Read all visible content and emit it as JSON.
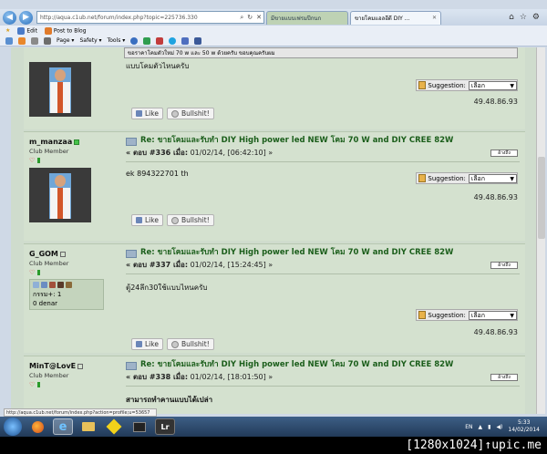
{
  "browser": {
    "address_url": "http://aqua.c1ub.net/forum/index.php?topic=225736.330",
    "tabs": [
      {
        "label": "มีขายแบบเฟรมปีกนก",
        "active": false
      },
      {
        "label": "ขายโคมแอลอีดี DIY ...",
        "active": true
      }
    ],
    "favorites": {
      "edit": "Edit",
      "post_to_blog": "Post to Blog"
    },
    "commands": {
      "page": "Page ▾",
      "safety": "Safety ▾",
      "tools": "Tools ▾"
    }
  },
  "top_post": {
    "quote_text": "ขอราคาโคมตัวใหม่ 70 w และ 50 w ด้วยครับ ขอบคุณครับผม",
    "text": "แบบโคมตัวไหนครับ",
    "suggestion_label": "Suggestion:",
    "suggestion_value": "เลือก",
    "ip": "49.48.86.93",
    "like_label": "Like",
    "bullshit_label": "Bullshit!"
  },
  "posts": [
    {
      "username": "m_manzaa",
      "online": true,
      "rank": "Club Member",
      "title": "Re: ขายโคมและรับทำ DIY High power led NEW โคม 70 W and DIY CREE 82W",
      "post_no_prefix": "« ตอบ #336 เมื่อ:",
      "post_date": "01/02/14, [06:42:10] »",
      "quote_label": "อ้างถึง",
      "text": "ek 894322701 th",
      "suggestion_label": "Suggestion:",
      "suggestion_value": "เลือก",
      "ip": "49.48.86.93",
      "like_label": "Like",
      "bullshit_label": "Bullshit!"
    },
    {
      "username": "G_GOM",
      "online": false,
      "rank": "Club Member",
      "karma_label": "กรรม+: 1",
      "money_label": "0 denar",
      "title": "Re: ขายโคมและรับทำ DIY High power led NEW โคม 70 W and DIY CREE 82W",
      "post_no_prefix": "« ตอบ #337 เมื่อ:",
      "post_date": "01/02/14, [15:24:45] »",
      "quote_label": "อ้างถึง",
      "text": "ตู้24ลึก30ใช้แบบไหนครับ",
      "suggestion_label": "Suggestion:",
      "suggestion_value": "เลือก",
      "ip": "49.48.86.93",
      "like_label": "Like",
      "bullshit_label": "Bullshit!"
    },
    {
      "username": "MinT@LovE",
      "online": false,
      "rank": "Club Member",
      "title": "Re: ขายโคมและรับทำ DIY High power led NEW โคม 70 W and DIY CREE 82W",
      "post_no_prefix": "« ตอบ #338 เมื่อ:",
      "post_date": "01/02/14, [18:01:50] »",
      "quote_label": "อ้างถึง",
      "text": "สามารถทำคานแบบได้เปล่า"
    }
  ],
  "status_bar": "http://aqua.c1ub.net/forum/index.php?action=profile;u=53657",
  "taskbar": {
    "lang": "EN",
    "time": "5:33",
    "date": "14/02/2014",
    "apps": [
      "firefox",
      "internet-explorer",
      "explorer",
      "photos",
      "player",
      "lightroom"
    ],
    "lightroom_label": "Lr"
  },
  "banner": "[1280x1024]↑upic.me",
  "colors": {
    "post_bg": "#d4e1cf",
    "title_green": "#1b5e1b",
    "taskbar": "#223a58"
  }
}
